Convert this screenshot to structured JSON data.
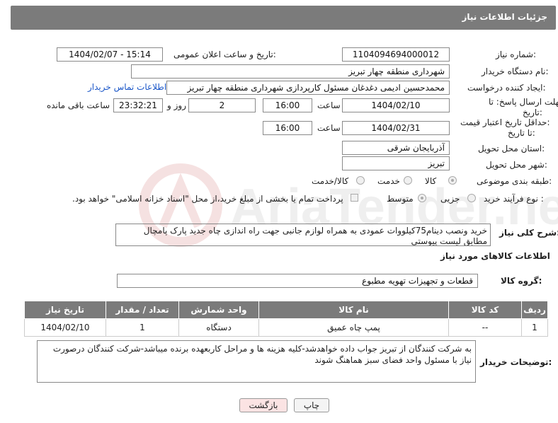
{
  "header": {
    "title": "جزئیات اطلاعات نیاز"
  },
  "need_number": {
    "label": "شماره نیاز:",
    "value": "1104094694000012"
  },
  "announce_datetime": {
    "label": "تاریخ و ساعت اعلان عمومی:",
    "value": "1404/02/07 - 15:14"
  },
  "buyer_org": {
    "label": "نام دستگاه خریدار:",
    "value": "شهرداری منطقه چهار تبریز"
  },
  "requester": {
    "label": "ایجاد کننده درخواست:",
    "value": "محمدحسین ادیمی دغدغان مسئول کارپردازی شهرداری منطقه چهار تبریز",
    "contact_link": "اطلاعات تماس خریدار"
  },
  "deadline_reply": {
    "label_line1": "مهلت ارسال پاسخ: تا",
    "label_line2": "تاریخ:",
    "date": "1404/02/10",
    "time_label": "ساعت",
    "time": "16:00",
    "days": "2",
    "days_label": "روز و",
    "remaining": "23:32:21",
    "remaining_label": "ساعت باقی مانده"
  },
  "price_validity": {
    "label_line1": "حداقل تاریخ اعتبار قیمت:",
    "label_line2": "تا تاریخ:",
    "date": "1404/02/31",
    "time_label": "ساعت",
    "time": "16:00"
  },
  "delivery_province": {
    "label": "استان محل تحویل:",
    "value": "آذربایجان شرقی"
  },
  "delivery_city": {
    "label": "شهر محل تحویل:",
    "value": "تبریز"
  },
  "category": {
    "label": "طبقه بندی موضوعی:",
    "options": [
      "کالا",
      "خدمت",
      "کالا/خدمت"
    ],
    "selected": "کالا"
  },
  "process_type": {
    "label": "نوع فرآیند خرید :",
    "options": [
      "جزیی",
      "متوسط"
    ],
    "selected": "متوسط",
    "note": "پرداخت تمام یا بخشی از مبلغ خرید،از محل \"اسناد خزانه اسلامی\" خواهد بود."
  },
  "description": {
    "label": "شرح کلی نیاز:",
    "value": "خرید ونصب دینام75کیلووات عمودی به همراه لوازم جانبی جهت راه اندازی چاه جدید پارک پامچال مطابق لیست پیوستی"
  },
  "goods_info": {
    "title": "اطلاعات کالاهای مورد نیاز"
  },
  "goods_group": {
    "label": "گروه کالا:",
    "value": "قطعات و تجهیزات تهویه مطبوع"
  },
  "items_table": {
    "headers": [
      "ردیف",
      "کد کالا",
      "نام کالا",
      "واحد شمارش",
      "تعداد / مقدار",
      "تاریخ نیاز"
    ],
    "rows": [
      [
        "1",
        "--",
        "پمپ چاه عمیق",
        "دستگاه",
        "1",
        "1404/02/10"
      ]
    ]
  },
  "buyer_notes": {
    "label": "توضیحات خریدار:",
    "value": "به شرکت کنندگان از تبریز جواب داده خواهدشد-کلیه هزینه ها و مراحل کاربعهده برنده میباشد-شرکت کنندگان درصورت نیاز با مسئول واحد فضای سبز هماهنگ شوند"
  },
  "buttons": {
    "print": "چاپ",
    "back": "بازگشت"
  },
  "watermark": {
    "text": "AriaTender.neT"
  },
  "colors": {
    "header_bg": "#7b7b7b",
    "link": "#1a56c8",
    "back_button_bg": "#fbe3e3"
  }
}
